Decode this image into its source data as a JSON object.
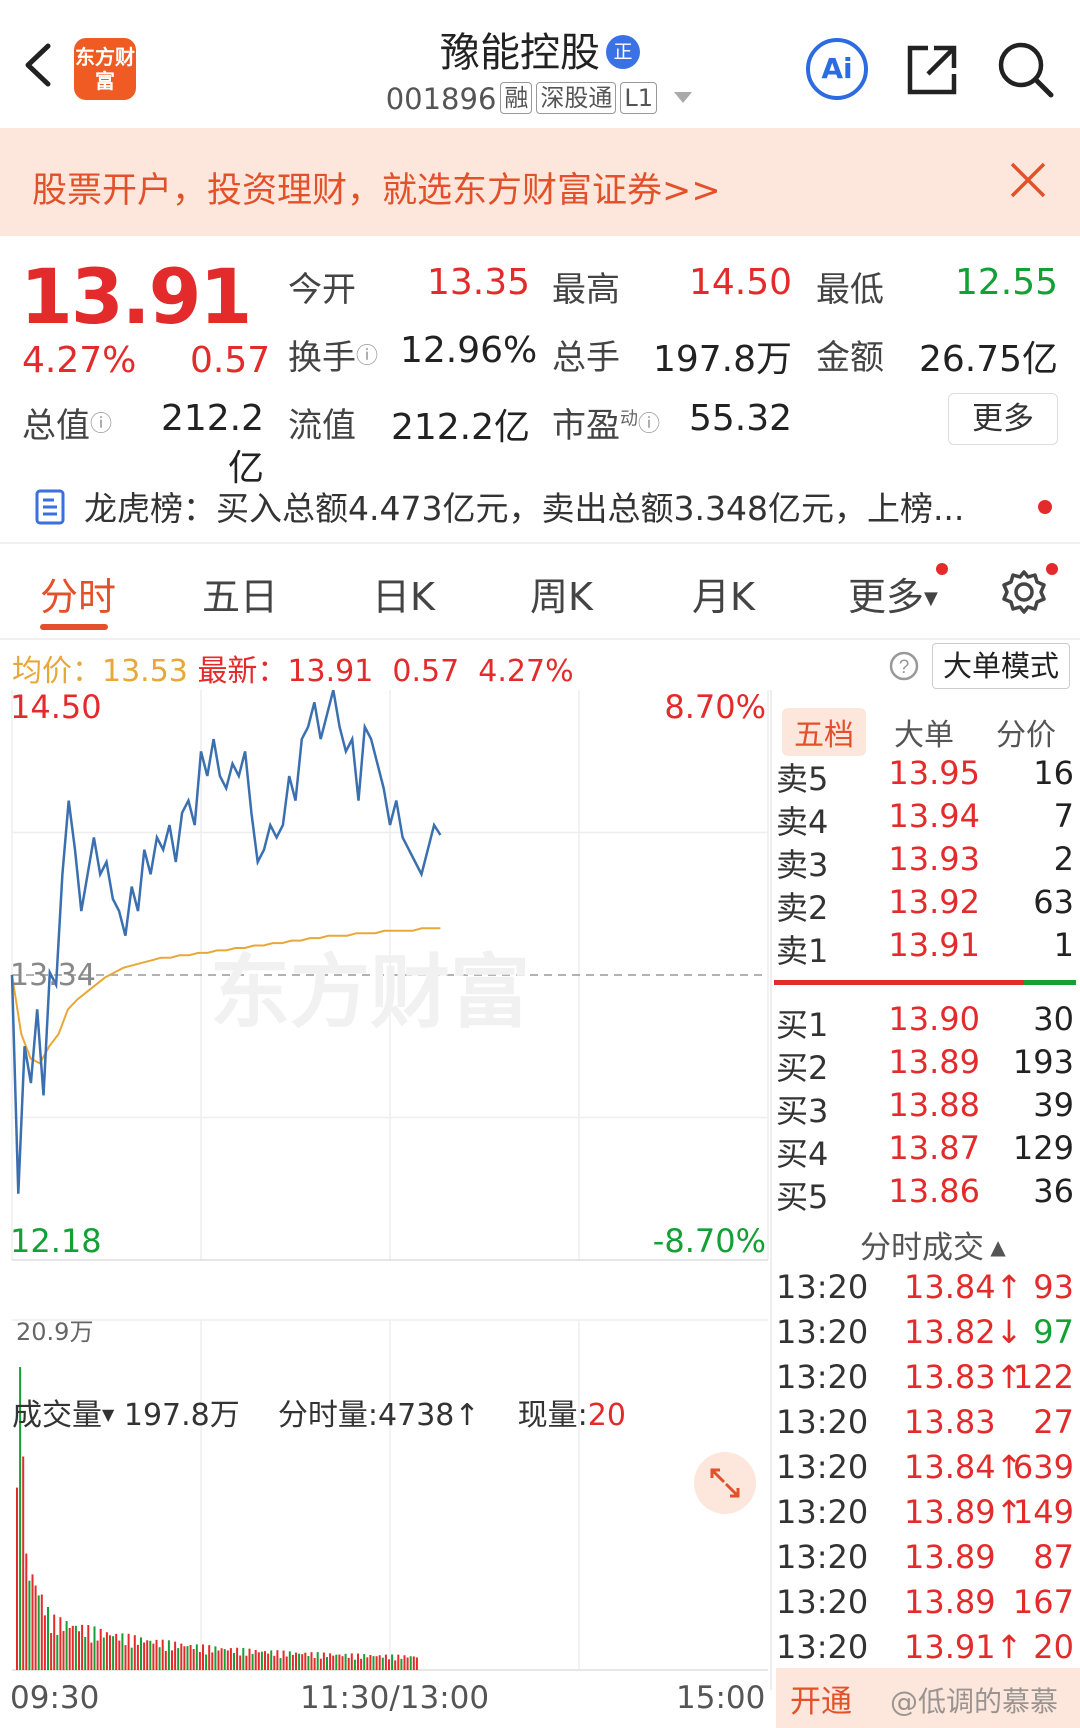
{
  "header": {
    "logo_text": "东方财富",
    "stock_name": "豫能控股",
    "badge": "正",
    "code": "001896",
    "tags": [
      "融",
      "深股通",
      "L1"
    ],
    "ai_label": "Ai"
  },
  "banner": {
    "text": "股票开户，投资理财，就选东方财富证券>>"
  },
  "quote": {
    "price": "13.91",
    "change_pct": "4.27%",
    "change_abs": "0.57",
    "fields": [
      {
        "label": "今开",
        "value": "13.35",
        "color": "red"
      },
      {
        "label": "最高",
        "value": "14.50",
        "color": "red"
      },
      {
        "label": "最低",
        "value": "12.55",
        "color": "green"
      },
      {
        "label": "换手",
        "value": "12.96%",
        "color": "black"
      },
      {
        "label": "总手",
        "value": "197.8万",
        "color": "black"
      },
      {
        "label": "金额",
        "value": "26.75亿",
        "color": "black"
      },
      {
        "label": "总值",
        "value": "212.2亿",
        "color": "black"
      },
      {
        "label": "流值",
        "value": "212.2亿",
        "color": "black"
      },
      {
        "label": "市盈",
        "value": "55.32",
        "color": "black"
      }
    ],
    "pe_sup": "动",
    "more": "更多"
  },
  "dragon_tiger": {
    "text": "龙虎榜：买入总额4.473亿元，卖出总额3.348亿元，上榜..."
  },
  "tabs": [
    "分时",
    "五日",
    "日K",
    "周K",
    "月K",
    "更多"
  ],
  "avg_row": {
    "avg_label": "均价：",
    "avg_value": "13.53",
    "latest_label": "最新：",
    "latest_value": "13.91",
    "change_abs": "0.57",
    "change_pct": "4.27%",
    "big_order": "大单模式"
  },
  "chart_data": {
    "type": "line",
    "y_top": "14.50",
    "y_bottom": "12.18",
    "pct_top": "8.70%",
    "pct_bottom": "-8.70%",
    "prev_close_label": "13.34",
    "ylim": [
      12.18,
      14.5
    ],
    "prev_close": 13.34,
    "price": [
      13.34,
      12.45,
      13.05,
      12.9,
      13.2,
      12.85,
      13.35,
      13.3,
      13.75,
      14.05,
      13.85,
      13.6,
      13.75,
      13.9,
      13.75,
      13.8,
      13.65,
      13.6,
      13.5,
      13.7,
      13.6,
      13.85,
      13.75,
      13.9,
      13.85,
      13.95,
      13.8,
      14.0,
      14.05,
      13.95,
      14.25,
      14.15,
      14.3,
      14.15,
      14.1,
      14.2,
      14.15,
      14.25,
      14.0,
      13.8,
      13.85,
      13.95,
      13.9,
      13.95,
      14.15,
      14.05,
      14.3,
      14.35,
      14.45,
      14.3,
      14.4,
      14.5,
      14.35,
      14.25,
      14.3,
      14.05,
      14.35,
      14.3,
      14.2,
      14.1,
      13.95,
      14.05,
      13.9,
      13.85,
      13.8,
      13.75,
      13.85,
      13.95,
      13.91
    ],
    "avg": [
      13.34,
      13.1,
      13.0,
      12.98,
      13.05,
      13.1,
      13.2,
      13.24,
      13.27,
      13.3,
      13.33,
      13.35,
      13.37,
      13.38,
      13.39,
      13.4,
      13.41,
      13.41,
      13.42,
      13.42,
      13.43,
      13.43,
      13.44,
      13.44,
      13.45,
      13.45,
      13.46,
      13.46,
      13.47,
      13.47,
      13.48,
      13.48,
      13.49,
      13.49,
      13.5,
      13.5,
      13.5,
      13.51,
      13.51,
      13.51,
      13.52,
      13.52,
      13.52,
      13.52,
      13.53,
      13.53,
      13.53
    ],
    "x_labels": [
      "09:30",
      "11:30/13:00",
      "15:00"
    ]
  },
  "orderbook": {
    "tabs": [
      "五档",
      "大单",
      "分价"
    ],
    "sells": [
      {
        "label": "卖5",
        "price": "13.95",
        "vol": "16"
      },
      {
        "label": "卖4",
        "price": "13.94",
        "vol": "7"
      },
      {
        "label": "卖3",
        "price": "13.93",
        "vol": "2"
      },
      {
        "label": "卖2",
        "price": "13.92",
        "vol": "63"
      },
      {
        "label": "卖1",
        "price": "13.91",
        "vol": "1"
      }
    ],
    "buys": [
      {
        "label": "买1",
        "price": "13.90",
        "vol": "30"
      },
      {
        "label": "买2",
        "price": "13.89",
        "vol": "193"
      },
      {
        "label": "买3",
        "price": "13.88",
        "vol": "39"
      },
      {
        "label": "买4",
        "price": "13.87",
        "vol": "129"
      },
      {
        "label": "买5",
        "price": "13.86",
        "vol": "36"
      }
    ]
  },
  "trades": {
    "header": "分时成交",
    "rows": [
      {
        "time": "13:20",
        "price": "13.84↑",
        "vol": "93",
        "pcolor": "red",
        "vcolor": "red"
      },
      {
        "time": "13:20",
        "price": "13.82↓",
        "vol": "97",
        "pcolor": "red",
        "vcolor": "green"
      },
      {
        "time": "13:20",
        "price": "13.83↑",
        "vol": "122",
        "pcolor": "red",
        "vcolor": "red"
      },
      {
        "time": "13:20",
        "price": "13.83",
        "vol": "27",
        "pcolor": "red",
        "vcolor": "red"
      },
      {
        "time": "13:20",
        "price": "13.84↑",
        "vol": "639",
        "pcolor": "red",
        "vcolor": "red"
      },
      {
        "time": "13:20",
        "price": "13.89↑",
        "vol": "149",
        "pcolor": "red",
        "vcolor": "red"
      },
      {
        "time": "13:20",
        "price": "13.89",
        "vol": "87",
        "pcolor": "red",
        "vcolor": "red"
      },
      {
        "time": "13:20",
        "price": "13.89",
        "vol": "167",
        "pcolor": "red",
        "vcolor": "red"
      },
      {
        "time": "13:20",
        "price": "13.91↑",
        "vol": "20",
        "pcolor": "red",
        "vcolor": "red"
      }
    ]
  },
  "volume": {
    "label": "成交量",
    "total": "197.8万",
    "minute_label": "分时量:",
    "minute_value": "4738",
    "current_label": "现量:",
    "current_value": "20",
    "max_label": "20.9万"
  },
  "bottom": {
    "open_text": "开通",
    "watermark": "@低调的慕慕",
    "chart_watermark": "东方财富"
  },
  "colors": {
    "up": "#e32b2b",
    "down": "#14a035",
    "accent": "#e3512a",
    "line": "#3a6fb0",
    "avg": "#e8a838"
  }
}
